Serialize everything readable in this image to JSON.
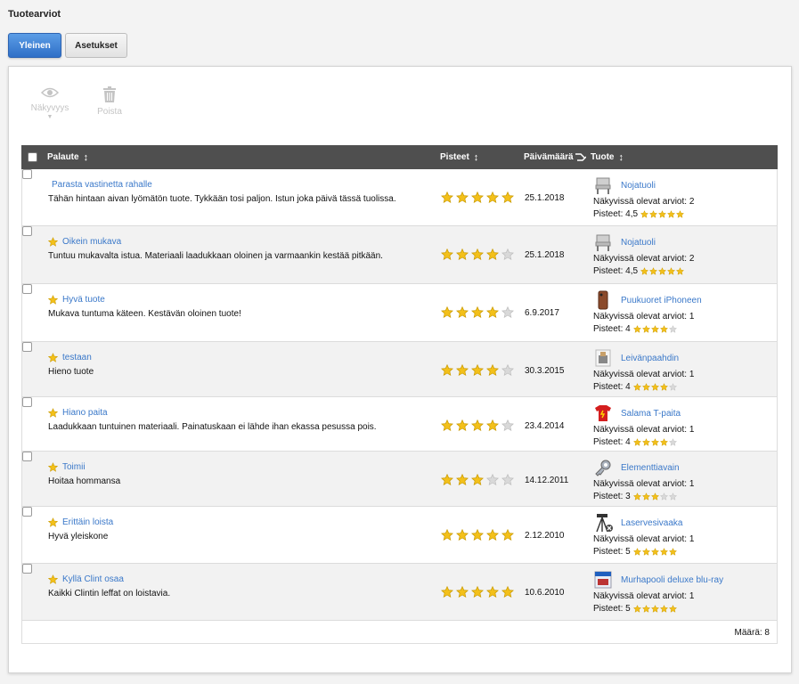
{
  "page": {
    "title": "Tuotearviot"
  },
  "tabs": [
    {
      "label": "Yleinen",
      "active": true
    },
    {
      "label": "Asetukset",
      "active": false
    }
  ],
  "toolbar": {
    "visibility_label": "Näkyvyys",
    "visibility_caret": "▼",
    "delete_label": "Poista"
  },
  "columns": {
    "feedback": "Palaute",
    "score": "Pisteet",
    "date": "Päivämäärä",
    "product": "Tuote"
  },
  "colors": {
    "star_full": "#f3c01a",
    "star_empty": "#d9d9d9",
    "link": "#3a78c9",
    "header_bg": "#4f4f4f",
    "tab_active": "#3f86d8"
  },
  "product_labels": {
    "visible_reviews": "Näkyvissä olevat arviot:",
    "score": "Pisteet:"
  },
  "reviews": [
    {
      "title": "Parasta vastinetta rahalle",
      "text": "Tähän hintaan aivan lyömätön tuote. Tykkään tosi paljon. Istun joka päivä tässä tuolissa.",
      "stars": 5,
      "date": "25.1.2018",
      "title_icon": "none",
      "product": {
        "name": "Nojatuoli",
        "thumb": "chair-icon",
        "count": "2",
        "score": "4,5",
        "stars": 5
      }
    },
    {
      "title": "Oikein mukava",
      "text": "Tuntuu mukavalta istua. Materiaali laadukkaan oloinen ja varmaankin kestää pitkään.",
      "stars": 4,
      "date": "25.1.2018",
      "title_icon": "star-icon",
      "product": {
        "name": "Nojatuoli",
        "thumb": "chair-icon",
        "count": "2",
        "score": "4,5",
        "stars": 5
      }
    },
    {
      "title": "Hyvä tuote",
      "text": "Mukava tuntuma käteen. Kestävän oloinen tuote!",
      "stars": 4,
      "date": "6.9.2017",
      "title_icon": "star-icon",
      "product": {
        "name": "Puukuoret iPhoneen",
        "thumb": "phone-case-icon",
        "count": "1",
        "score": "4",
        "stars": 4
      }
    },
    {
      "title": "testaan",
      "text": "Hieno tuote",
      "stars": 4,
      "date": "30.3.2015",
      "title_icon": "star-icon",
      "product": {
        "name": "Leivänpaahdin",
        "thumb": "toaster-icon",
        "count": "1",
        "score": "4",
        "stars": 4
      }
    },
    {
      "title": "Hiano paita",
      "text": "Laadukkaan tuntuinen materiaali. Painatuskaan ei lähde ihan ekassa pesussa pois.",
      "stars": 4,
      "date": "23.4.2014",
      "title_icon": "star-icon",
      "product": {
        "name": "Salama T-paita",
        "thumb": "tshirt-icon",
        "count": "1",
        "score": "4",
        "stars": 4
      }
    },
    {
      "title": "Toimii",
      "text": "Hoitaa hommansa",
      "stars": 3,
      "date": "14.12.2011",
      "title_icon": "star-icon",
      "product": {
        "name": "Elementtiavain",
        "thumb": "key-icon",
        "count": "1",
        "score": "3",
        "stars": 3
      }
    },
    {
      "title": "Erittäin loista",
      "text": "Hyvä yleiskone",
      "stars": 5,
      "date": "2.12.2010",
      "title_icon": "star-icon",
      "product": {
        "name": "Laservesivaaka",
        "thumb": "laser-level-icon",
        "count": "1",
        "score": "5",
        "stars": 5
      }
    },
    {
      "title": "Kyllä Clint osaa",
      "text": "Kaikki Clintin leffat on loistavia.",
      "stars": 5,
      "date": "10.6.2010",
      "title_icon": "star-icon",
      "product": {
        "name": "Murhapooli deluxe blu-ray",
        "thumb": "bluray-icon",
        "count": "1",
        "score": "5",
        "stars": 5
      }
    }
  ],
  "footer": {
    "count_label": "Määrä: 8"
  }
}
